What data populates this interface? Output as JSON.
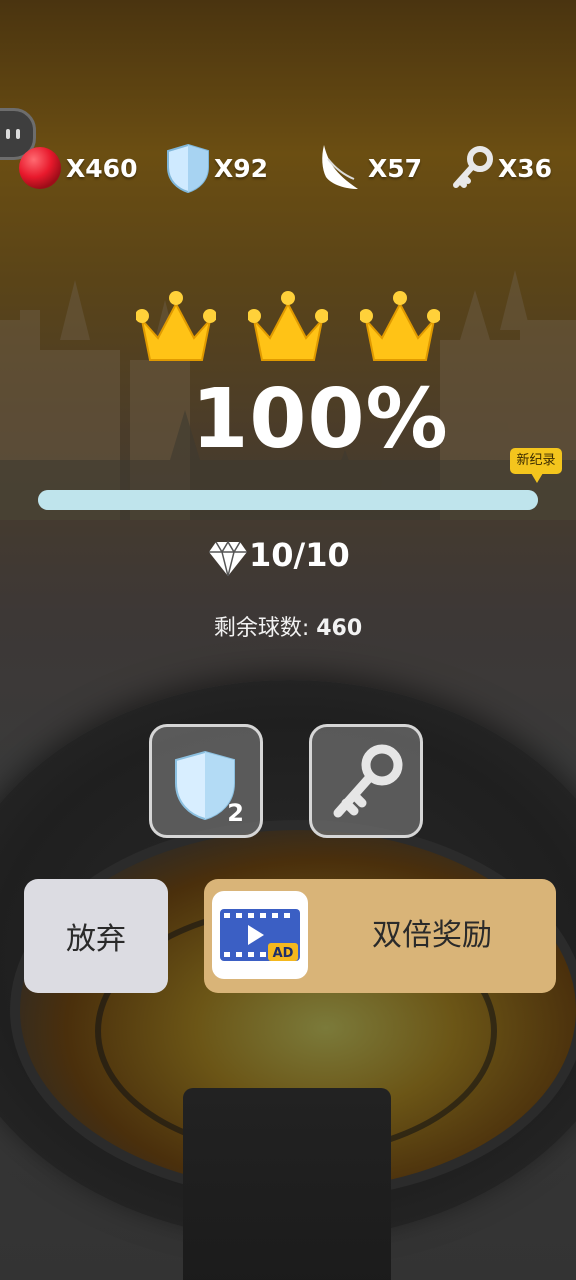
{
  "resources": {
    "balls": "X460",
    "shields": "X92",
    "wings": "X57",
    "keys": "X36"
  },
  "level": {
    "crowns_earned": 3,
    "percent": "100%",
    "progress": 1.0,
    "record_badge": "新纪录",
    "gems": "10/10",
    "remaining_label": "剩余球数:",
    "remaining_value": "460"
  },
  "powerups": {
    "shield_count": "2"
  },
  "actions": {
    "give_up": "放弃",
    "double_reward": "双倍奖励",
    "ad_label": "AD"
  },
  "colors": {
    "accent_gold": "#f4c51d",
    "ball_red": "#e8192c",
    "progress_fill": "#bfe4ec",
    "double_button": "#d9b478"
  },
  "icons": [
    "pause-icon",
    "red-ball-icon",
    "shield-icon",
    "wing-icon",
    "key-icon",
    "crown-icon",
    "diamond-icon",
    "video-ad-icon"
  ]
}
